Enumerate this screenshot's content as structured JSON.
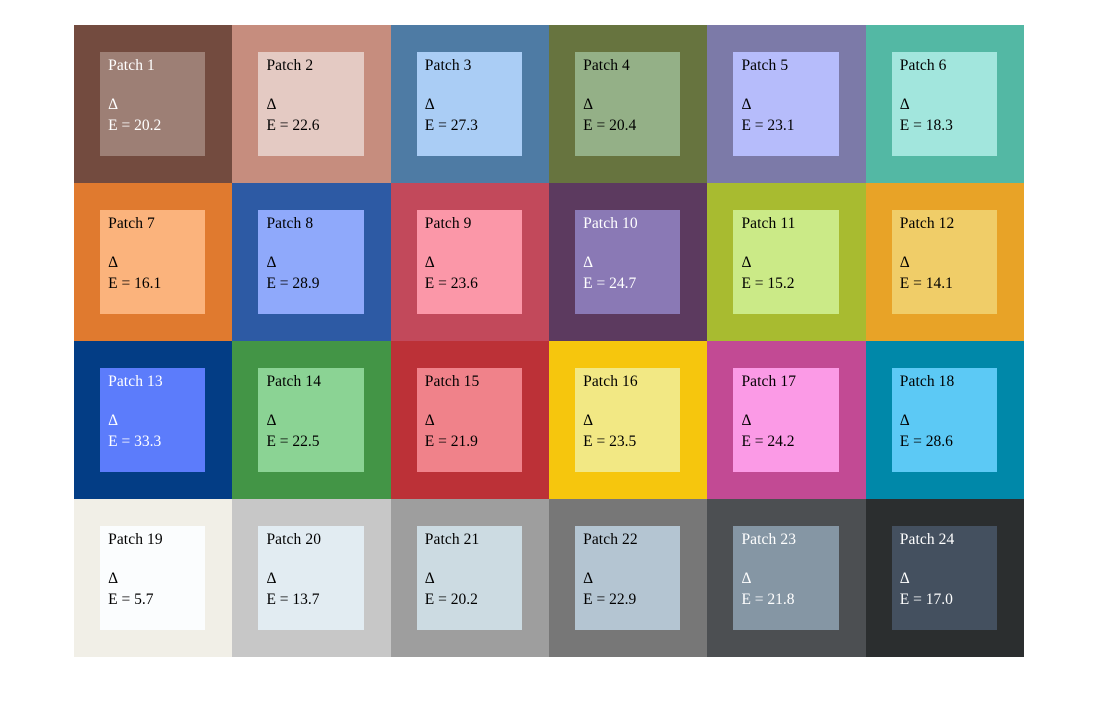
{
  "figure": {
    "background": "#ffffff",
    "grid_columns": 6,
    "grid_rows": 4,
    "delta_symbol": "Δ"
  },
  "chart_data": {
    "type": "heatmap",
    "title": "",
    "subtitle": "",
    "xlabel": "",
    "ylabel": "",
    "grid": false,
    "legend_position": "none",
    "columns": 6,
    "rows": 4,
    "value_label": "ΔE",
    "categories": [
      "Patch 1",
      "Patch 2",
      "Patch 3",
      "Patch 4",
      "Patch 5",
      "Patch 6",
      "Patch 7",
      "Patch 8",
      "Patch 9",
      "Patch 10",
      "Patch 11",
      "Patch 12",
      "Patch 13",
      "Patch 14",
      "Patch 15",
      "Patch 16",
      "Patch 17",
      "Patch 18",
      "Patch 19",
      "Patch 20",
      "Patch 21",
      "Patch 22",
      "Patch 23",
      "Patch 24"
    ],
    "values": [
      20.2,
      22.6,
      27.3,
      20.4,
      23.1,
      18.3,
      16.1,
      28.9,
      23.6,
      24.7,
      15.2,
      14.1,
      33.3,
      22.5,
      21.9,
      23.5,
      24.2,
      28.6,
      5.7,
      13.7,
      20.2,
      22.9,
      21.8,
      17.0
    ]
  },
  "patches": [
    {
      "label": "Patch 1",
      "delta": "Δ",
      "evalue": "E = 20.2",
      "outer": "#734b3f",
      "inner": "#9d7f75",
      "text": "#ffffff"
    },
    {
      "label": "Patch 2",
      "delta": "Δ",
      "evalue": "E = 22.6",
      "outer": "#c68d7e",
      "inner": "#e4cac3",
      "text": "#000000"
    },
    {
      "label": "Patch 3",
      "delta": "Δ",
      "evalue": "E = 27.3",
      "outer": "#4e7ba4",
      "inner": "#aacdf5",
      "text": "#000000"
    },
    {
      "label": "Patch 4",
      "delta": "Δ",
      "evalue": "E = 20.4",
      "outer": "#67743f",
      "inner": "#94b087",
      "text": "#000000"
    },
    {
      "label": "Patch 5",
      "delta": "Δ",
      "evalue": "E = 23.1",
      "outer": "#7c7aa8",
      "inner": "#b6bcfb",
      "text": "#000000"
    },
    {
      "label": "Patch 6",
      "delta": "Δ",
      "evalue": "E = 18.3",
      "outer": "#53b8a4",
      "inner": "#a2e6dd",
      "text": "#000000"
    },
    {
      "label": "Patch 7",
      "delta": "Δ",
      "evalue": "E = 16.1",
      "outer": "#e07a2f",
      "inner": "#fbb37c",
      "text": "#000000"
    },
    {
      "label": "Patch 8",
      "delta": "Δ",
      "evalue": "E = 28.9",
      "outer": "#2d5aa4",
      "inner": "#8fa9fb",
      "text": "#000000"
    },
    {
      "label": "Patch 9",
      "delta": "Δ",
      "evalue": "E = 23.6",
      "outer": "#c2495b",
      "inner": "#fb97a8",
      "text": "#000000"
    },
    {
      "label": "Patch 10",
      "delta": "Δ",
      "evalue": "E = 24.7",
      "outer": "#5c3a5f",
      "inner": "#8a79b5",
      "text": "#ffffff"
    },
    {
      "label": "Patch 11",
      "delta": "Δ",
      "evalue": "E = 15.2",
      "outer": "#a8bb30",
      "inner": "#cbea87",
      "text": "#000000"
    },
    {
      "label": "Patch 12",
      "delta": "Δ",
      "evalue": "E = 14.1",
      "outer": "#e8a327",
      "inner": "#f0cd68",
      "text": "#000000"
    },
    {
      "label": "Patch 13",
      "delta": "Δ",
      "evalue": "E = 33.3",
      "outer": "#033d85",
      "inner": "#5c7cfb",
      "text": "#ffffff"
    },
    {
      "label": "Patch 14",
      "delta": "Δ",
      "evalue": "E = 22.5",
      "outer": "#439546",
      "inner": "#8bd394",
      "text": "#000000"
    },
    {
      "label": "Patch 15",
      "delta": "Δ",
      "evalue": "E = 21.9",
      "outer": "#bc3137",
      "inner": "#f0828a",
      "text": "#000000"
    },
    {
      "label": "Patch 16",
      "delta": "Δ",
      "evalue": "E = 23.5",
      "outer": "#f6c60d",
      "inner": "#f2e884",
      "text": "#000000"
    },
    {
      "label": "Patch 17",
      "delta": "Δ",
      "evalue": "E = 24.2",
      "outer": "#c24a94",
      "inner": "#fb9ae6",
      "text": "#000000"
    },
    {
      "label": "Patch 18",
      "delta": "Δ",
      "evalue": "E = 28.6",
      "outer": "#0088a9",
      "inner": "#5cc9f5",
      "text": "#000000"
    },
    {
      "label": "Patch 19",
      "delta": "Δ",
      "evalue": "E = 5.7",
      "outer": "#f1efe7",
      "inner": "#fbfdfe",
      "text": "#000000"
    },
    {
      "label": "Patch 20",
      "delta": "Δ",
      "evalue": "E = 13.7",
      "outer": "#c7c7c7",
      "inner": "#e2ecf2",
      "text": "#000000"
    },
    {
      "label": "Patch 21",
      "delta": "Δ",
      "evalue": "E = 20.2",
      "outer": "#9e9e9e",
      "inner": "#ccdbe2",
      "text": "#000000"
    },
    {
      "label": "Patch 22",
      "delta": "Δ",
      "evalue": "E = 22.9",
      "outer": "#777777",
      "inner": "#b4c5d2",
      "text": "#000000"
    },
    {
      "label": "Patch 23",
      "delta": "Δ",
      "evalue": "E = 21.8",
      "outer": "#4c4f52",
      "inner": "#8596a4",
      "text": "#ffffff"
    },
    {
      "label": "Patch 24",
      "delta": "Δ",
      "evalue": "E = 17.0",
      "outer": "#2b2e2f",
      "inner": "#44505f",
      "text": "#ffffff"
    }
  ]
}
